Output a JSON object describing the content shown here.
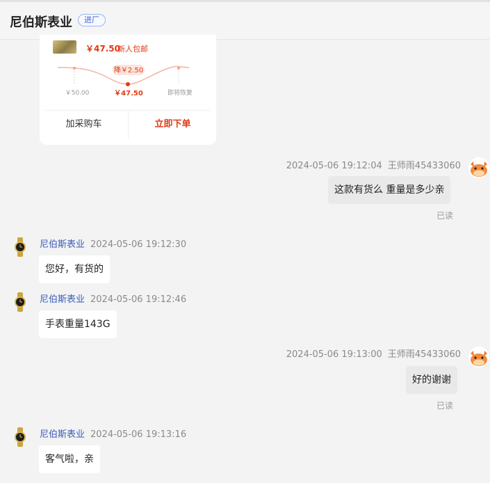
{
  "header": {
    "shop_name": "尼伯斯表业",
    "badge": "进厂"
  },
  "product_card": {
    "price": "￥47.50",
    "promo": "新人包邮",
    "drop_label": "降￥2.50",
    "point_before": "￥50.00",
    "point_now": "￥47.50",
    "point_after": "即将恢复",
    "add_cart": "加采购车",
    "buy_now": "立即下单"
  },
  "messages": [
    {
      "side": "right",
      "time": "2024-05-06 19:12:04",
      "sender": "王师雨45433060",
      "text": "这款有货么 重量是多少亲",
      "status": "已读"
    },
    {
      "side": "left",
      "sender": "尼伯斯表业",
      "time": "2024-05-06 19:12:30",
      "text": "您好，有货的"
    },
    {
      "side": "left",
      "sender": "尼伯斯表业",
      "time": "2024-05-06 19:12:46",
      "text": "手表重量143G"
    },
    {
      "side": "right",
      "time": "2024-05-06 19:13:00",
      "sender": "王师雨45433060",
      "text": "好的谢谢",
      "status": "已读"
    },
    {
      "side": "left",
      "sender": "尼伯斯表业",
      "time": "2024-05-06 19:13:16",
      "text": "客气啦，亲"
    }
  ],
  "colors": {
    "accent_red": "#e23a14",
    "shop_name_blue": "#3d5db8",
    "badge_blue": "#3a63d8",
    "chat_bg": "#f3f3f3"
  },
  "icons": {
    "shop_avatar": "gold-watch-icon",
    "user_avatar": "cartoon-cow-icon"
  }
}
